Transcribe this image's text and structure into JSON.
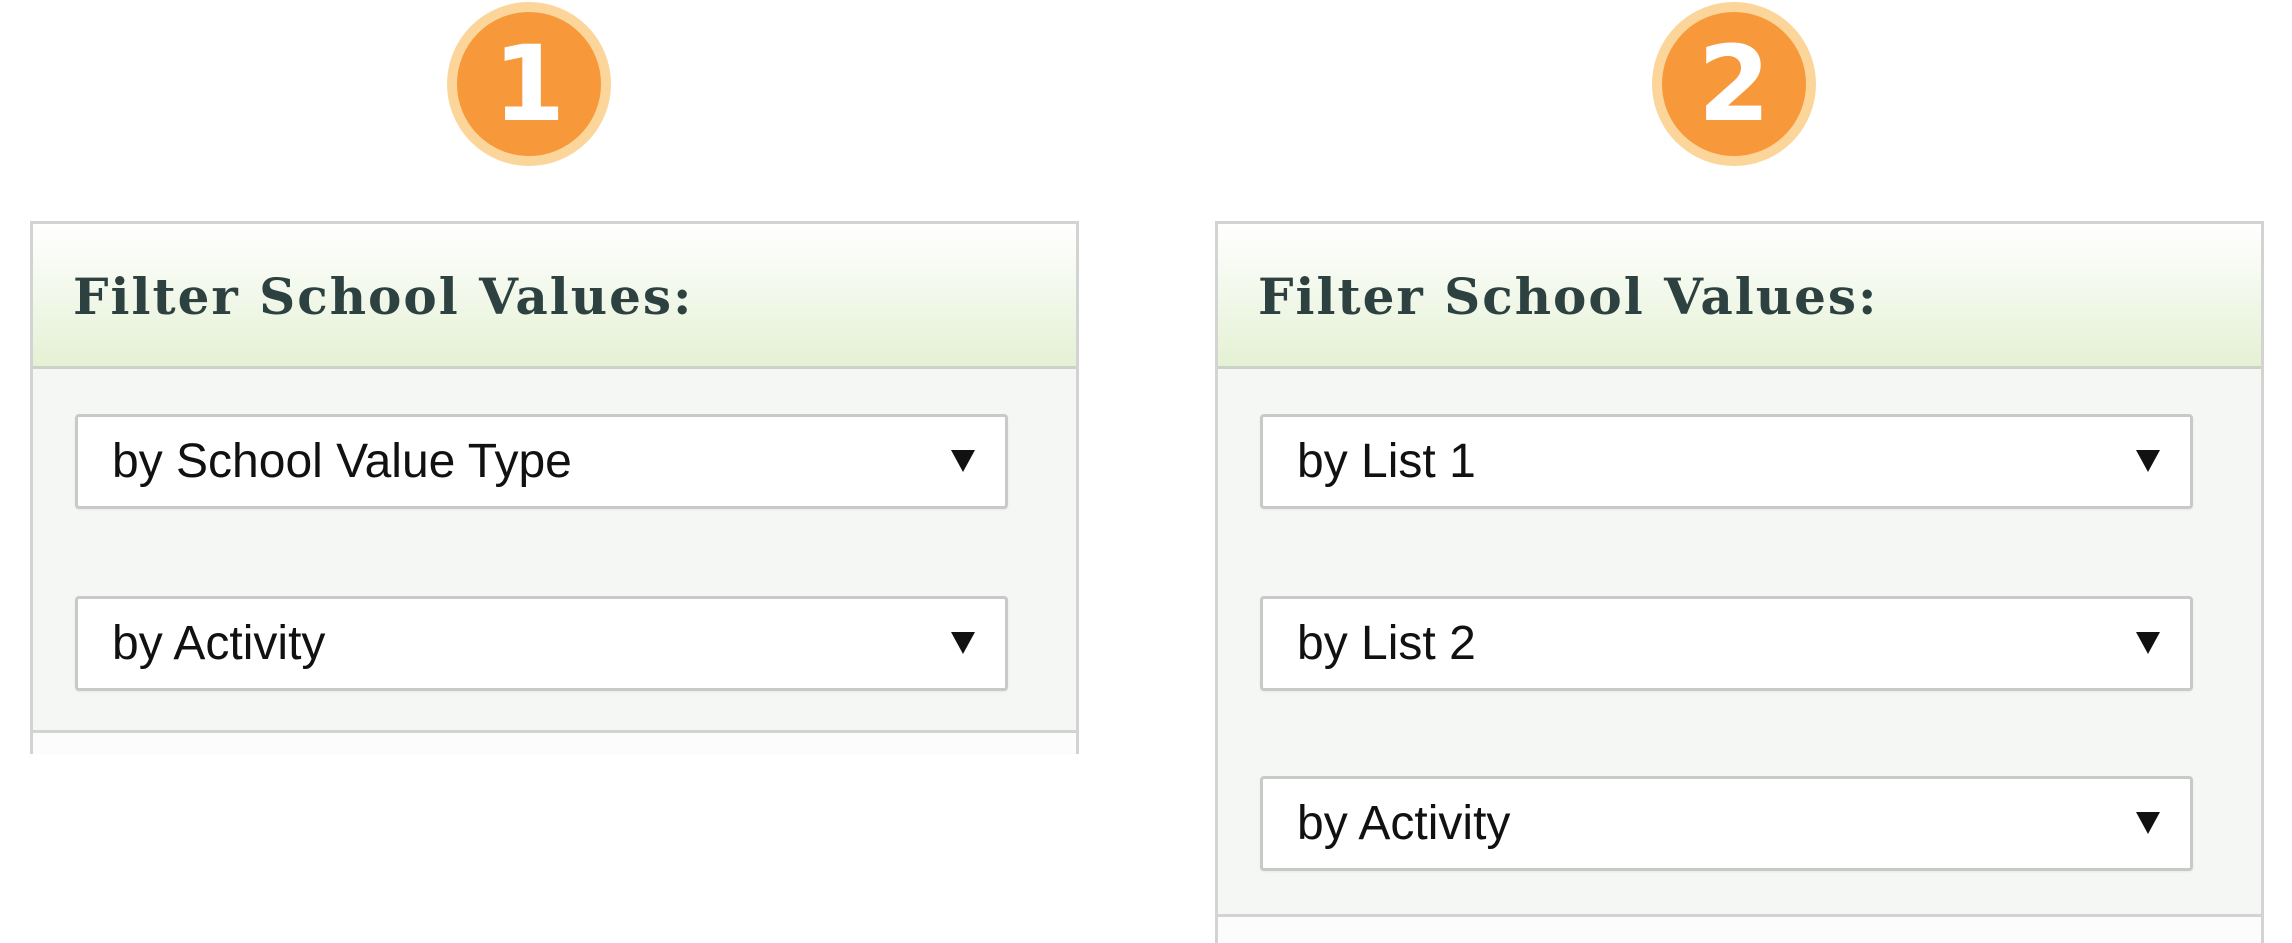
{
  "badges": {
    "first": "1",
    "second": "2"
  },
  "colors": {
    "badge_fill": "#f7983a",
    "badge_ring": "#fbd59a",
    "header_gradient_end": "#e4f1d4",
    "title_text": "#2d4140",
    "panel_body": "#f5f7f5"
  },
  "panel_1": {
    "title": "Filter School Values:",
    "selects": [
      {
        "value": "by School Value Type",
        "icon": "dropdown-arrow"
      },
      {
        "value": "by Activity",
        "icon": "dropdown-arrow"
      }
    ]
  },
  "panel_2": {
    "title": "Filter School Values:",
    "selects": [
      {
        "value": "by List 1",
        "icon": "dropdown-arrow"
      },
      {
        "value": "by List 2",
        "icon": "dropdown-arrow"
      },
      {
        "value": "by Activity",
        "icon": "dropdown-arrow"
      }
    ]
  }
}
